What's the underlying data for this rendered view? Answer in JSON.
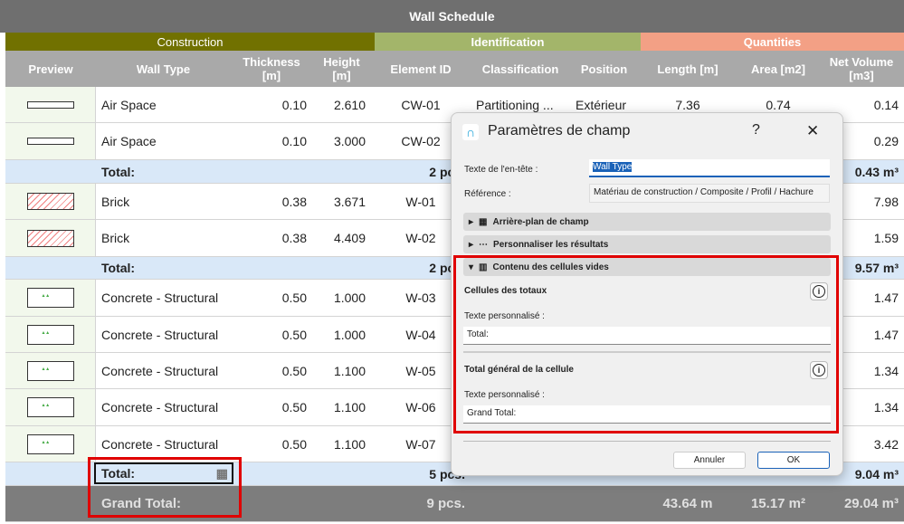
{
  "title": "Wall Schedule",
  "groups": [
    {
      "label": "Construction",
      "color": "#717100"
    },
    {
      "label": "Identification",
      "color": "#a3b56a"
    },
    {
      "label": "Quantities",
      "color": "#f3a085"
    }
  ],
  "headers": [
    "Preview",
    "Wall Type",
    "Thickness\n[m]",
    "Height\n[m]",
    "Element ID",
    "Classification",
    "Position",
    "Length [m]",
    "Area [m2]",
    "Net Volume\n[m3]"
  ],
  "rows": [
    {
      "type": "item",
      "preview": "air-space",
      "cells": [
        "Air Space",
        "0.10",
        "2.610",
        "CW-01",
        "Partitioning ...",
        "Extérieur",
        "7.36",
        "0.74",
        "0.14"
      ]
    },
    {
      "type": "item",
      "preview": "air-space",
      "cells": [
        "Air Space",
        "0.10",
        "3.000",
        "CW-02",
        "",
        "",
        "",
        "",
        "0.29"
      ]
    },
    {
      "type": "total",
      "label": "Total:",
      "pcs": "2 pcs.",
      "volume": "0.43 m³"
    },
    {
      "type": "item",
      "preview": "brick",
      "cells": [
        "Brick",
        "0.38",
        "3.671",
        "W-01",
        "",
        "",
        "",
        "",
        "7.98"
      ]
    },
    {
      "type": "item",
      "preview": "brick",
      "cells": [
        "Brick",
        "0.38",
        "4.409",
        "W-02",
        "",
        "",
        "",
        "",
        "1.59"
      ]
    },
    {
      "type": "total",
      "label": "Total:",
      "pcs": "2 pcs.",
      "volume": "9.57 m³"
    },
    {
      "type": "item",
      "preview": "concrete",
      "cells": [
        "Concrete - Structural",
        "0.50",
        "1.000",
        "W-03",
        "",
        "",
        "",
        "",
        "1.47"
      ]
    },
    {
      "type": "item",
      "preview": "concrete",
      "cells": [
        "Concrete - Structural",
        "0.50",
        "1.000",
        "W-04",
        "",
        "",
        "",
        "",
        "1.47"
      ]
    },
    {
      "type": "item",
      "preview": "concrete",
      "cells": [
        "Concrete - Structural",
        "0.50",
        "1.100",
        "W-05",
        "",
        "",
        "",
        "",
        "1.34"
      ]
    },
    {
      "type": "item",
      "preview": "concrete",
      "cells": [
        "Concrete - Structural",
        "0.50",
        "1.100",
        "W-06",
        "",
        "",
        "",
        "",
        "1.34"
      ]
    },
    {
      "type": "item",
      "preview": "concrete",
      "cells": [
        "Concrete - Structural",
        "0.50",
        "1.100",
        "W-07",
        "",
        "",
        "",
        "",
        "3.42"
      ]
    },
    {
      "type": "total",
      "label": "Total:",
      "pcs": "5 pcs.",
      "volume": "9.04 m³"
    },
    {
      "type": "grand",
      "label": "Grand Total:",
      "pcs": "9 pcs.",
      "length": "43.64 m",
      "area": "15.17 m²",
      "volume": "29.04 m³"
    }
  ],
  "dialog": {
    "title": "Paramètres de champ",
    "help": "?",
    "close": "✕",
    "header_label": "Texte de l'en-tête :",
    "header_value": "Wall Type",
    "reference_label": "Référence :",
    "reference_value": "Matériau de construction / Composite / Profil / Hachure",
    "sections": [
      "Arrière-plan de champ",
      "Personnaliser les résultats",
      "Contenu des cellules vides"
    ],
    "totals_title": "Cellules des totaux",
    "custom_label": "Texte personnalisé :",
    "totals_value": "Total:",
    "grand_title": "Total général de la cellule",
    "grand_value": "Grand Total:",
    "cancel": "Annuler",
    "ok": "OK"
  }
}
